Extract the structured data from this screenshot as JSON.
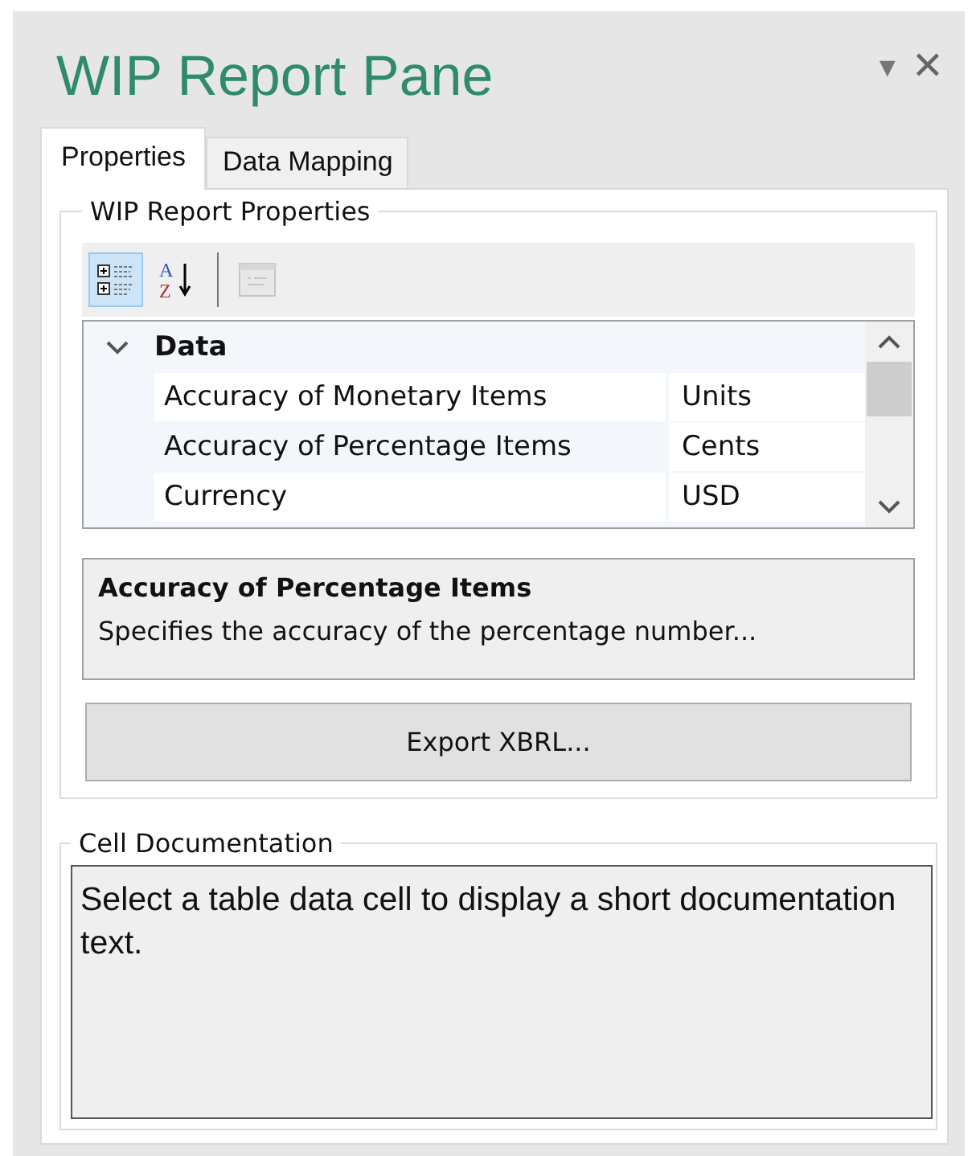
{
  "pane": {
    "title": "WIP Report Pane",
    "menu_glyph": "▾",
    "close_glyph": "✕"
  },
  "tabs": [
    {
      "label": "Properties",
      "selected": true
    },
    {
      "label": "Data Mapping",
      "selected": false
    }
  ],
  "properties_group": {
    "title": "WIP Report Properties",
    "toolbar": [
      {
        "kind": "categorized",
        "selected": true,
        "disabled": false
      },
      {
        "kind": "alphabetical",
        "selected": false,
        "disabled": false,
        "letters": [
          "A",
          "Z"
        ]
      },
      {
        "kind": "pages",
        "selected": false,
        "disabled": true
      }
    ],
    "grid": {
      "category": {
        "label": "Data",
        "expanded": true
      },
      "rows": [
        {
          "name": "Accuracy of Monetary Items",
          "value": "Units",
          "selected": false
        },
        {
          "name": "Accuracy of Percentage Items",
          "value": "Cents",
          "selected": true
        },
        {
          "name": "Currency",
          "value": "USD",
          "selected": false
        }
      ]
    },
    "description": {
      "title": "Accuracy of Percentage Items",
      "text": "Specifies the accuracy of the percentage number..."
    },
    "button": "Export XBRL..."
  },
  "documentation_group": {
    "title": "Cell Documentation",
    "text": "Select a table data cell to display a short documentation text."
  }
}
